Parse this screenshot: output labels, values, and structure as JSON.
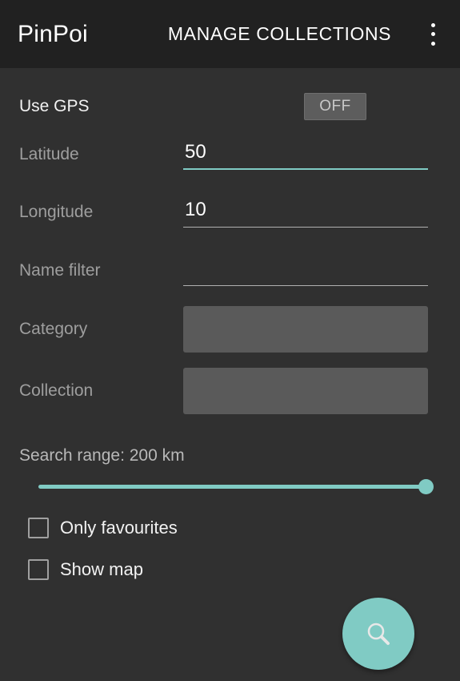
{
  "toolbar": {
    "app_title": "PinPoi",
    "action_label": "MANAGE COLLECTIONS",
    "overflow_icon": "more-vert-icon"
  },
  "form": {
    "gps": {
      "label": "Use GPS",
      "toggle_value": "OFF"
    },
    "latitude": {
      "label": "Latitude",
      "value": "50",
      "focused": true
    },
    "longitude": {
      "label": "Longitude",
      "value": "10",
      "focused": false
    },
    "name_filter": {
      "label": "Name filter",
      "value": "",
      "placeholder": "",
      "focused": false
    },
    "category": {
      "label": "Category",
      "value": ""
    },
    "collection": {
      "label": "Collection",
      "value": ""
    },
    "search_range": {
      "label": "Search range: 200 km",
      "value": 200,
      "unit": "km",
      "percent": 100
    },
    "only_favourites": {
      "label": "Only favourites",
      "checked": false
    },
    "show_map": {
      "label": "Show map",
      "checked": false
    }
  },
  "fab": {
    "icon": "search-icon"
  },
  "colors": {
    "accent": "#80cbc4",
    "toolbar_bg": "#212121",
    "body_bg": "#303030",
    "spinner_bg": "#5a5a5a",
    "label_gray": "#9e9e9e"
  }
}
